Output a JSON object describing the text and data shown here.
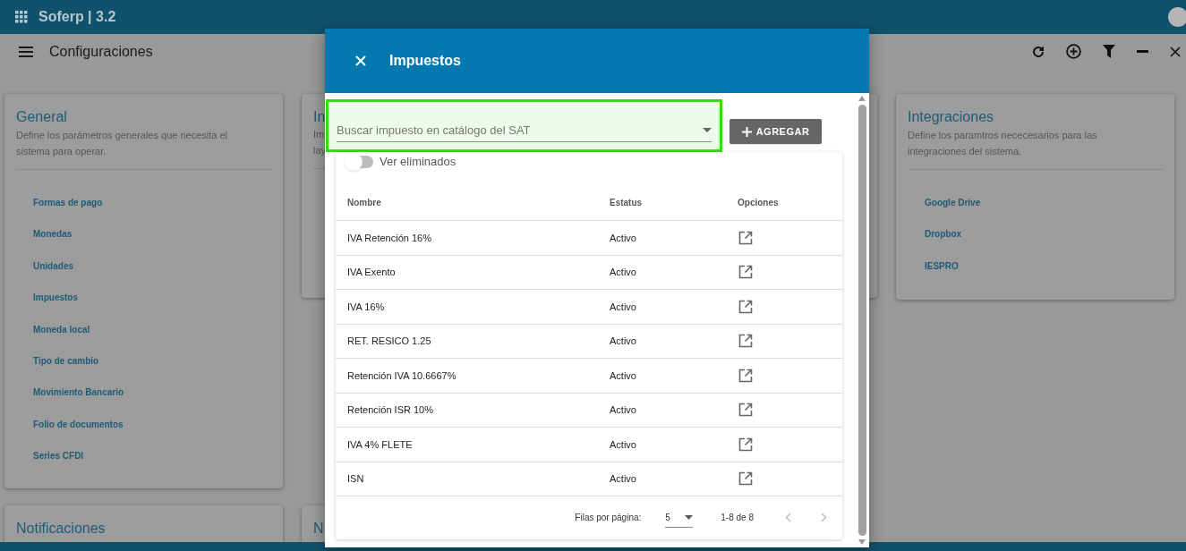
{
  "app": {
    "title": "Soferp | 3.2"
  },
  "page": {
    "title": "Configuraciones"
  },
  "cards": [
    {
      "title": "General",
      "description": "Define los parámetros generales que necesita el sistema para operar.",
      "links": [
        "Formas de pago",
        "Monedas",
        "Unidades",
        "Impuestos",
        "Moneda local",
        "Tipo de cambio",
        "Movimiento Bancario",
        "Folio de documentos",
        "Series CFDI"
      ]
    },
    {
      "title": "In",
      "lines": [
        "Im",
        "lay"
      ]
    },
    {
      "title": "Integraciones",
      "description": "Define los paramtros nececesarios para las integraciones del sistema.",
      "links": [
        "Google Drive",
        "Dropbox",
        "IESPRO"
      ]
    },
    {
      "title": "Notificaciones"
    },
    {
      "title": "N"
    }
  ],
  "dialog": {
    "title": "Impuestos",
    "search": {
      "placeholder": "Buscar impuesto en catálogo del SAT"
    },
    "add_button": "AGREGAR",
    "toggle": {
      "label": "Ver eliminados",
      "on": false
    },
    "columns": [
      "Nombre",
      "Estatus",
      "Opciones"
    ],
    "rows": [
      {
        "name": "IVA Retención 16%",
        "status": "Activo"
      },
      {
        "name": "IVA Exento",
        "status": "Activo"
      },
      {
        "name": "IVA 16%",
        "status": "Activo"
      },
      {
        "name": "RET. RESICO 1.25",
        "status": "Activo"
      },
      {
        "name": "Retención IVA 10.6667%",
        "status": "Activo"
      },
      {
        "name": "Retención ISR 10%",
        "status": "Activo"
      },
      {
        "name": "IVA 4% FLETE",
        "status": "Activo"
      },
      {
        "name": "ISN",
        "status": "Activo"
      }
    ],
    "pagination": {
      "label": "Filas por página:",
      "rows_per_page": "5",
      "range": "1-8 de 8"
    }
  }
}
